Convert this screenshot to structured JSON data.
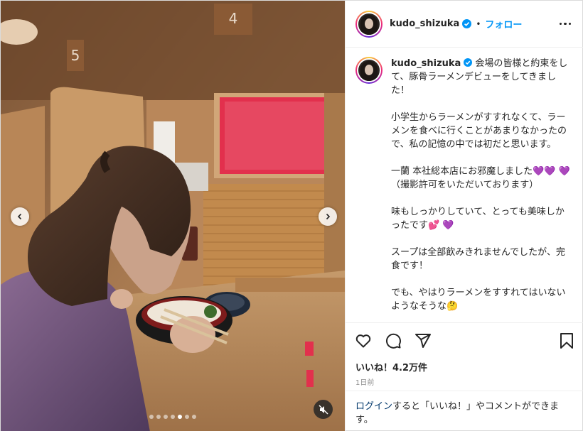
{
  "post": {
    "username": "kudo_shizuka",
    "verified": true,
    "separator": "•",
    "follow_label": "フォロー",
    "more_icon": "more-horizontal-icon"
  },
  "caption": {
    "username": "kudo_shizuka",
    "paragraphs": [
      "会場の皆様と約束をして、豚骨ラーメンデビューをしてきました！",
      "小学生からラーメンがすすれなくて、ラーメンを食べに行くことがあまりなかったので、私の記憶の中では初だと思います。",
      "一蘭 本社総本店にお邪魔しました💜💜 💜\n（撮影許可をいただいております）",
      "味もしっかりしていて、とっても美味しかったです💕 💜",
      "スープは全部飲みきれませんでしたが、完食です！",
      "でも、やはりラーメンをすすれてはいないようなそうな🤔"
    ]
  },
  "media": {
    "booth_numbers": [
      "5",
      "4"
    ],
    "carousel_total": 7,
    "carousel_active": 4,
    "mute_icon": "speaker-muted-icon"
  },
  "actions": {
    "like_icon": "heart-icon",
    "comment_icon": "comment-icon",
    "share_icon": "share-icon",
    "save_icon": "bookmark-icon"
  },
  "likes_text": "いいね！4.2万件",
  "time_text": "1日前",
  "login": {
    "link": "ログイン",
    "rest": "すると「いいね！」やコメントができます。"
  },
  "colors": {
    "accent": "#0095f6",
    "verified": "#0095f6",
    "link": "#00376b"
  }
}
